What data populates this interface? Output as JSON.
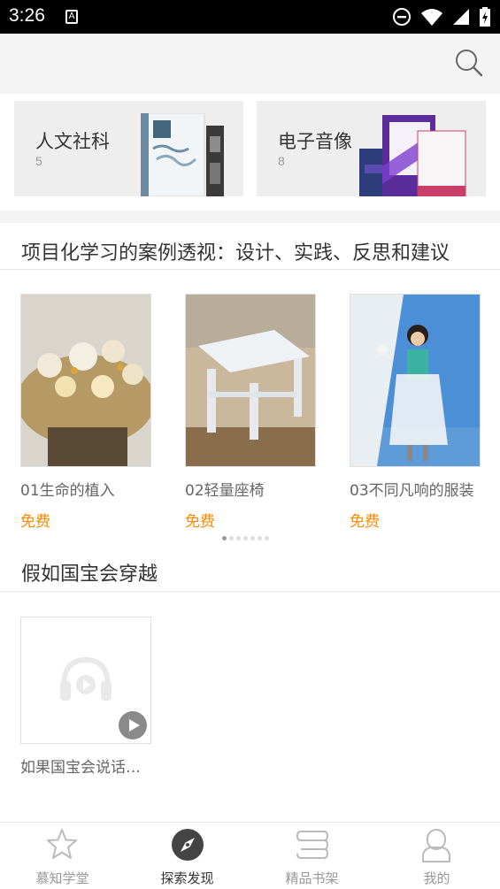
{
  "status_bar": {
    "time": "3:26"
  },
  "categories": [
    {
      "name": "人文社科",
      "count": "5"
    },
    {
      "name": "电子音像",
      "count": "8"
    }
  ],
  "section1": {
    "title": "项目化学习的案例透视：设计、实践、反思和建议",
    "items": [
      {
        "title": "01生命的植入",
        "price": "免费"
      },
      {
        "title": "02轻量座椅",
        "price": "免费"
      },
      {
        "title": "03不同凡响的服装",
        "price": "免费"
      }
    ],
    "page_indicator": {
      "total": 7,
      "active": 1
    }
  },
  "section2": {
    "title": "假如国宝会穿越",
    "items": [
      {
        "title": "如果国宝会说话第一季"
      }
    ]
  },
  "bottom_nav": [
    {
      "label": "慕知学堂",
      "icon": "star-icon",
      "active": false
    },
    {
      "label": "探索发现",
      "icon": "compass-icon",
      "active": true
    },
    {
      "label": "精品书架",
      "icon": "bookshelf-icon",
      "active": false
    },
    {
      "label": "我的",
      "icon": "person-icon",
      "active": false
    }
  ],
  "colors": {
    "accent_price": "#ff8a00",
    "topbar_bg": "#f4f4f4",
    "category_bg": "#eeeeee"
  }
}
